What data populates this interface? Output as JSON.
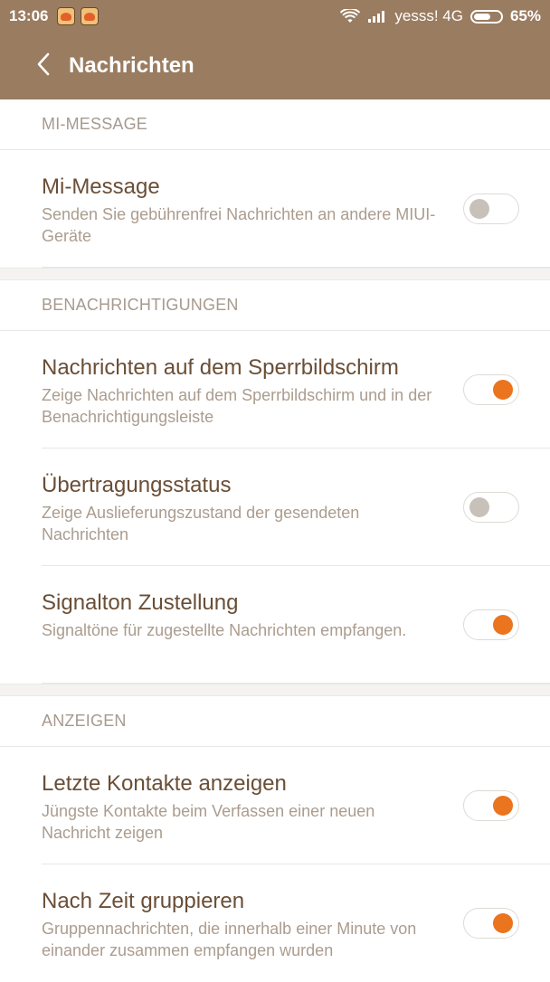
{
  "status_bar": {
    "time": "13:06",
    "carrier": "yesss! 4G",
    "battery_percent": "65%",
    "battery_level": 0.65
  },
  "toolbar": {
    "title": "Nachrichten"
  },
  "sections": [
    {
      "header": "MI-MESSAGE",
      "items": [
        {
          "title": "Mi-Message",
          "description": "Senden Sie gebührenfrei Nachrichten an andere MIUI-Geräte",
          "enabled": false
        }
      ]
    },
    {
      "header": "BENACHRICHTIGUNGEN",
      "items": [
        {
          "title": "Nachrichten auf dem Sperrbildschirm",
          "description": "Zeige Nachrichten auf dem Sperrbildschirm und in der Benachrichtigungsleiste",
          "enabled": true
        },
        {
          "title": "Übertragungsstatus",
          "description": "Zeige Auslieferungszustand der gesendeten Nachrichten",
          "enabled": false
        },
        {
          "title": "Signalton Zustellung",
          "description": "Signaltöne für zugestellte Nachrichten empfangen.",
          "enabled": true
        }
      ]
    },
    {
      "header": "ANZEIGEN",
      "items": [
        {
          "title": "Letzte Kontakte anzeigen",
          "description": "Jüngste Kontakte beim Verfassen einer neuen Nachricht zeigen",
          "enabled": true
        },
        {
          "title": "Nach Zeit gruppieren",
          "description": "Gruppennachrichten, die innerhalb einer Minute von einander zusammen empfangen wurden",
          "enabled": true
        }
      ]
    }
  ],
  "colors": {
    "header_bg": "#9a7c61",
    "toggle_on": "#eb741e",
    "toggle_off": "#c8c1ba",
    "title_text": "#6a4e36",
    "secondary_text": "#ab9c8e"
  },
  "icons": {
    "back": "chevron-left-icon",
    "notification_apps": [
      "app-notification-icon",
      "app-notification-icon"
    ],
    "wifi": "wifi-icon",
    "signal": "signal-icon",
    "battery": "battery-icon"
  }
}
